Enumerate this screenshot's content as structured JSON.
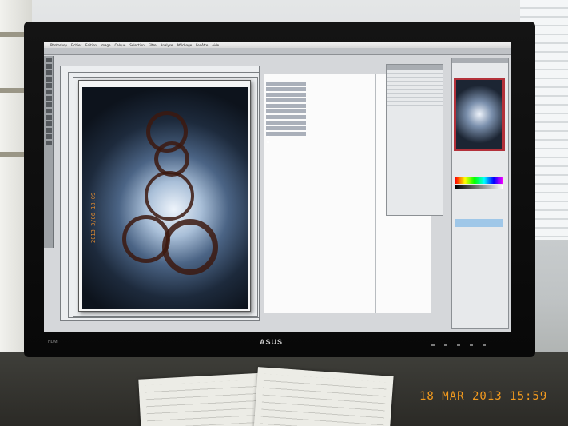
{
  "photo": {
    "date_stamp": "18 MAR 2013 15:59",
    "monitor_brand": "ASUS",
    "monitor_port_label": "HDMI"
  },
  "screen": {
    "menubar": [
      "Photoshop",
      "Fichier",
      "Edition",
      "Image",
      "Calque",
      "Sélection",
      "Filtre",
      "Analyse",
      "Affichage",
      "Fenêtre",
      "Aide"
    ],
    "canvas_stamp": "2013 3/06 18:09"
  },
  "colors": {
    "date_stamp": "#f29a1e",
    "accent_panel": "#b3313a",
    "bezel": "#0d0d0d"
  }
}
